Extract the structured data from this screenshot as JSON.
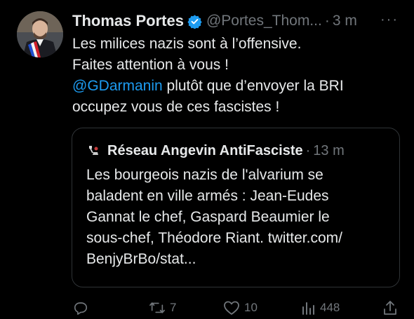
{
  "tweet": {
    "display_name": "Thomas Portes",
    "handle": "@Portes_Thom...",
    "separator": "·",
    "time": "3 m",
    "more_label": "···",
    "lines": {
      "l1": "Les milices nazis sont à l’offensive.",
      "l2": "Faites attention à vous !",
      "l3_mention": "@GDarmanin",
      "l3_rest": " plutôt que d’envoyer la BRI",
      "l4": "occupez vous de ces fascistes !"
    }
  },
  "quote": {
    "name": "Réseau Angevin AntiFasciste",
    "separator": "·",
    "time": "13 m",
    "lines": [
      "Les bourgeois nazis de l'alvarium se",
      "baladent en ville armés : Jean-Eudes",
      "Gannat le chef, Gaspard Beaumier le",
      "sous-chef, Théodore Riant. twitter.com/",
      "BenjyBrBo/stat..."
    ]
  },
  "actions": {
    "reply_count": "",
    "retweet_count": "7",
    "like_count": "10",
    "views_count": "448"
  },
  "colors": {
    "background": "#000000",
    "text": "#e7e9ea",
    "secondary": "#71767b",
    "link": "#1d9bf0",
    "verified": "#1d9bf0",
    "border": "#2f3336"
  },
  "icons": [
    "verified-badge-icon",
    "reply-icon",
    "retweet-icon",
    "like-icon",
    "views-icon",
    "share-icon",
    "more-icon"
  ]
}
